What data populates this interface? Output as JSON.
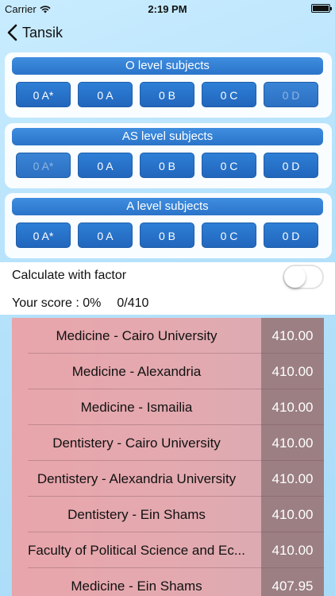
{
  "status_bar": {
    "carrier": "Carrier",
    "time": "2:19 PM"
  },
  "nav": {
    "back_label": "Tansik"
  },
  "panels": [
    {
      "title": "O level subjects",
      "grades": [
        "0 A*",
        "0 A",
        "0 B",
        "0 C",
        "0 D"
      ],
      "dimmed_index": 4
    },
    {
      "title": "AS level subjects",
      "grades": [
        "0 A*",
        "0 A",
        "0 B",
        "0 C",
        "0 D"
      ],
      "dimmed_index": 0
    },
    {
      "title": "A level subjects",
      "grades": [
        "0 A*",
        "0 A",
        "0 B",
        "0 C",
        "0 D"
      ],
      "dimmed_index": -1
    }
  ],
  "factor": {
    "label": "Calculate with factor",
    "enabled": false
  },
  "score": {
    "label": "Your score : 0%",
    "total": "0/410"
  },
  "results": [
    {
      "name": "Medicine - Cairo University",
      "score": "410.00"
    },
    {
      "name": "Medicine - Alexandria",
      "score": "410.00"
    },
    {
      "name": "Medicine - Ismailia",
      "score": "410.00"
    },
    {
      "name": "Dentistery - Cairo University",
      "score": "410.00"
    },
    {
      "name": "Dentistery - Alexandria University",
      "score": "410.00"
    },
    {
      "name": "Dentistery - Ein Shams",
      "score": "410.00"
    },
    {
      "name": "Faculty of Political Science and Ec...",
      "score": "410.00"
    },
    {
      "name": "Medicine - Ein Shams",
      "score": "407.95"
    }
  ],
  "colors": {
    "panel_blue": "#2a74c9",
    "results_pink": "#e8a5ab",
    "results_score_col": "#9b7f83"
  }
}
